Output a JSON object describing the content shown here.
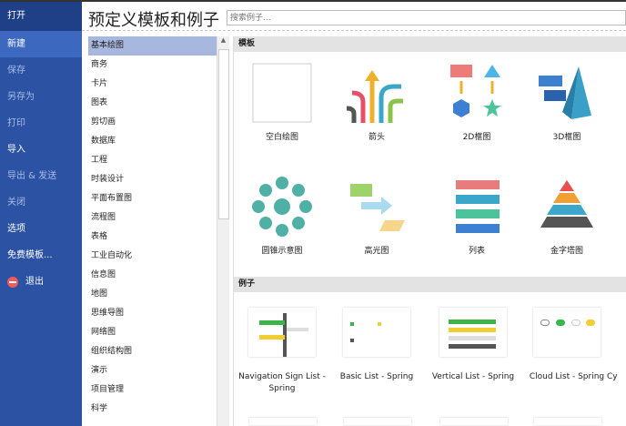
{
  "sidebar": {
    "items": [
      "打开",
      "新建",
      "保存",
      "另存为",
      "打印",
      "导入",
      "导出 & 发送",
      "关闭",
      "选项",
      "免费模板...",
      "退出"
    ]
  },
  "header": {
    "title": "预定义模板和例子",
    "search_placeholder": "搜索例子..."
  },
  "categories": [
    "基本绘图",
    "商务",
    "卡片",
    "图表",
    "剪切画",
    "数据库",
    "工程",
    "时装设计",
    "平面布置图",
    "流程图",
    "表格",
    "工业自动化",
    "信息图",
    "地图",
    "思维导图",
    "网络图",
    "组织结构图",
    "演示",
    "项目管理",
    "科学"
  ],
  "templates": {
    "header": "模板",
    "items": [
      "空白绘图",
      "箭头",
      "2D框图",
      "3D框图",
      "圆锥示意图",
      "高光图",
      "列表",
      "金字塔图"
    ]
  },
  "examples": {
    "header": "例子",
    "items": [
      "Navigation Sign List - Spring",
      "Basic List - Spring",
      "Vertical List - Spring",
      "Cloud List - Spring",
      "Cy"
    ]
  }
}
